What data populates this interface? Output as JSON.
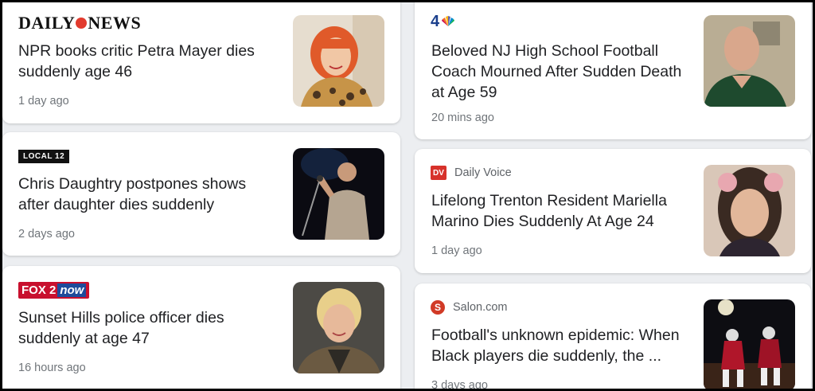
{
  "left_column": [
    {
      "source": "DAILY NEWS",
      "source_parts": [
        "DAILY",
        "NEWS"
      ],
      "headline": "NPR books critic Petra Mayer dies suddenly age 46",
      "time": "1 day ago"
    },
    {
      "source": "LOCAL 12",
      "headline": "Chris Daughtry postpones shows after daughter dies suddenly",
      "time": "2 days ago"
    },
    {
      "source": "FOX 2 now",
      "source_parts": [
        "FOX 2",
        "now"
      ],
      "headline": "Sunset Hills police officer dies suddenly at age 47",
      "time": "16 hours ago"
    }
  ],
  "right_column": [
    {
      "source": "4",
      "headline": "Beloved NJ High School Football Coach Mourned After Sudden Death at Age 59",
      "time": "20 mins ago"
    },
    {
      "source_icon": "DV",
      "source": "Daily Voice",
      "headline": "Lifelong Trenton Resident Mariella Marino Dies Suddenly At Age 24",
      "time": "1 day ago"
    },
    {
      "source_icon": "S",
      "source": "Salon.com",
      "headline": "Football's unknown epidemic: When Black players die suddenly, the ...",
      "time": "3 days ago"
    }
  ],
  "colors": {
    "page_background": "#eceef1",
    "card_background": "#ffffff",
    "headline_text": "#202124",
    "meta_text": "#70757a",
    "daily_voice_red": "#d7322b",
    "salon_red": "#d13a26",
    "fox_red": "#c8102e"
  },
  "icons": {
    "daily_news_logo": "daily-news-logo",
    "local12_logo": "local12-logo",
    "fox2_logo": "fox2-logo",
    "nbc4_logo": "nbc4-logo",
    "daily_voice_logo": "daily-voice-logo",
    "salon_logo": "salon-logo"
  }
}
